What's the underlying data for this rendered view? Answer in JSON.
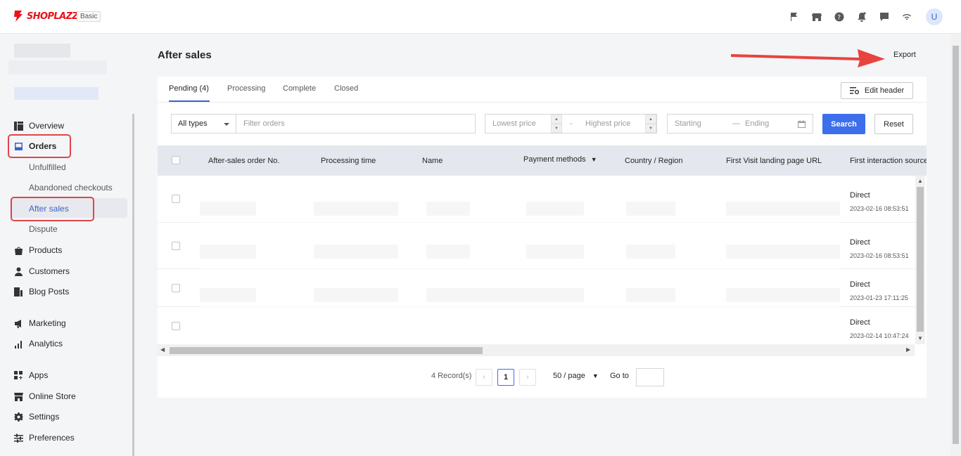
{
  "brand": {
    "name": "SHOPLAZZA",
    "plan": "Basic",
    "color": "#e8131b"
  },
  "topbar": {
    "icons": [
      "flag-icon",
      "store-icon",
      "help-icon",
      "bell-icon",
      "chat-icon",
      "wifi-icon"
    ],
    "avatar_initial": "U"
  },
  "sidebar": {
    "items": [
      {
        "label": "Overview",
        "icon": "overview-icon"
      },
      {
        "label": "Orders",
        "icon": "orders-icon"
      },
      {
        "label": "Unfulfilled"
      },
      {
        "label": "Abandoned checkouts"
      },
      {
        "label": "After sales",
        "active": true
      },
      {
        "label": "Dispute"
      },
      {
        "label": "Products",
        "icon": "bag-icon"
      },
      {
        "label": "Customers",
        "icon": "person-icon"
      },
      {
        "label": "Blog Posts",
        "icon": "blog-icon"
      },
      {
        "label": "Marketing",
        "icon": "megaphone-icon"
      },
      {
        "label": "Analytics",
        "icon": "bar-chart-icon"
      },
      {
        "label": "Apps",
        "icon": "apps-icon"
      },
      {
        "label": "Online Store",
        "icon": "store-icon"
      },
      {
        "label": "Settings",
        "icon": "gear-icon"
      },
      {
        "label": "Preferences",
        "icon": "sliders-icon"
      }
    ]
  },
  "page": {
    "title": "After sales",
    "export_label": "Export"
  },
  "tabs": [
    {
      "label": "Pending",
      "count": "(4)"
    },
    {
      "label": "Processing"
    },
    {
      "label": "Complete"
    },
    {
      "label": "Closed"
    }
  ],
  "edit_header_label": "Edit header",
  "filters": {
    "type_select": "All types",
    "filter_placeholder": "Filter orders",
    "lowest_price_placeholder": "Lowest price",
    "price_separator": "-",
    "highest_price_placeholder": "Highest price",
    "start_placeholder": "Starting",
    "date_separator": "—",
    "end_placeholder": "Ending",
    "search_label": "Search",
    "reset_label": "Reset"
  },
  "table": {
    "columns": [
      "After-sales order No.",
      "Processing time",
      "Name",
      "Payment methods",
      "Country / Region",
      "First Visit landing page URL",
      "First interaction source"
    ],
    "rows": [
      {
        "source": "Direct",
        "date": "2023-02-16 08:53:51"
      },
      {
        "source": "Direct",
        "date": "2023-02-16 08:53:51"
      },
      {
        "source": "Direct",
        "date": "2023-01-23 17:11:25"
      },
      {
        "source": "Direct",
        "date": "2023-02-14 10:47:24"
      }
    ]
  },
  "pagination": {
    "records": "4 Record(s)",
    "current_page": "1",
    "page_size": "50 / page",
    "goto_label": "Go to"
  },
  "colors": {
    "accent": "#3d6eec",
    "annotation_red": "#e0454a"
  }
}
